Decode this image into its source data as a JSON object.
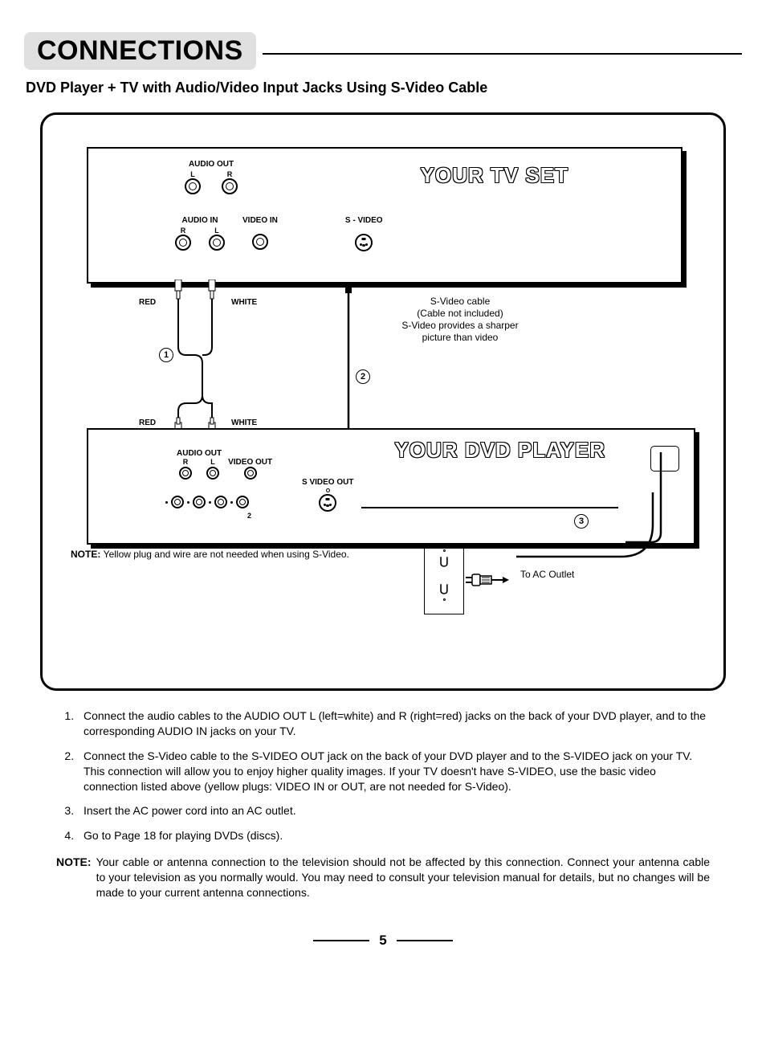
{
  "page": {
    "title": "CONNECTIONS",
    "subtitle": "DVD Player + TV with Audio/Video Input Jacks Using S-Video Cable",
    "number": "5"
  },
  "diagram": {
    "tv": {
      "title": "YOUR TV SET",
      "audio_out_label": "AUDIO OUT",
      "audio_out_l": "L",
      "audio_out_r": "R",
      "audio_in_label": "AUDIO IN",
      "audio_in_r": "R",
      "audio_in_l": "L",
      "video_in_label": "VIDEO IN",
      "svideo_label": "S - VIDEO"
    },
    "cable_colors": {
      "red": "RED",
      "white": "WHITE"
    },
    "markers": {
      "one": "1",
      "two": "2",
      "three": "3"
    },
    "svideo_note": {
      "l1": "S-Video cable",
      "l2": "(Cable not included)",
      "l3": "S-Video provides a sharper",
      "l4": "picture than video"
    },
    "dvd": {
      "title": "YOUR DVD PLAYER",
      "audio_out_label": "AUDIO  OUT",
      "audio_r": "R",
      "audio_l": "L",
      "video_out_label": "VIDEO OUT",
      "svideo_out_label": "S VIDEO OUT",
      "row2_label": "2"
    },
    "note_line": {
      "prefix": "NOTE: ",
      "text": "Yellow plug and wire are not needed when using S-Video."
    },
    "ac_label": "To AC Outlet"
  },
  "instructions": {
    "items": [
      "Connect the audio cables to the AUDIO OUT L (left=white) and R (right=red) jacks on the back of your DVD player, and to the corresponding AUDIO IN jacks on your TV.",
      "Connect the S-Video cable to the S-VIDEO OUT jack on the back of your DVD player and to the S-VIDEO jack on your TV. This connection will allow you to enjoy higher quality images. If your TV doesn't have S-VIDEO, use the basic video connection listed above (yellow plugs: VIDEO IN or OUT, are not needed for S-Video).",
      "Insert the AC power cord into an AC outlet.",
      "Go to Page 18 for playing DVDs (discs)."
    ],
    "note_label": "NOTE:",
    "note_text": "Your cable or antenna connection to the television should not be affected by this connection. Connect your antenna cable to your television as you normally would. You may need to consult your television manual for details, but no changes will be made to your current antenna connections."
  }
}
